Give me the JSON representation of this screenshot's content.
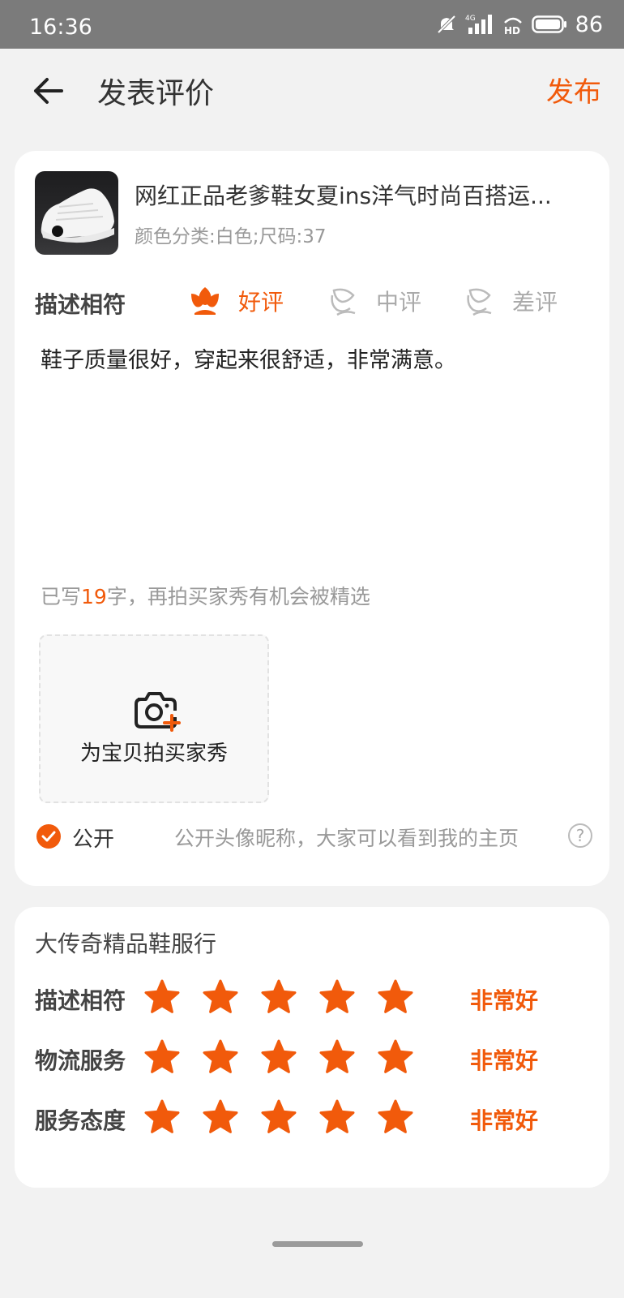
{
  "status_bar": {
    "time": "16:36",
    "network": "4G",
    "hd": "HD",
    "battery": "86"
  },
  "header": {
    "title": "发表评价",
    "publish": "发布"
  },
  "product": {
    "title": "网红正品老爹鞋女夏ins洋气时尚百搭运...",
    "spec": "颜色分类:白色;尺码:37"
  },
  "rating": {
    "label": "描述相符",
    "options": [
      "好评",
      "中评",
      "差评"
    ],
    "selected": "好评"
  },
  "review": {
    "text": "鞋子质量很好，穿起来很舒适，非常满意。",
    "count_prefix": "已写",
    "count": "19",
    "count_suffix": "字，再拍买家秀有机会被精选"
  },
  "upload": {
    "label": "为宝贝拍买家秀"
  },
  "public": {
    "checked": true,
    "label": "公开",
    "desc": "公开头像昵称，大家可以看到我的主页",
    "help": "?"
  },
  "shop": {
    "name": "大传奇精品鞋服行",
    "ratings": [
      {
        "label": "描述相符",
        "stars": 5,
        "verdict": "非常好"
      },
      {
        "label": "物流服务",
        "stars": 5,
        "verdict": "非常好"
      },
      {
        "label": "服务态度",
        "stars": 5,
        "verdict": "非常好"
      }
    ]
  },
  "colors": {
    "accent": "#f15a0b",
    "background": "#f2f2f2",
    "card": "#ffffff"
  }
}
